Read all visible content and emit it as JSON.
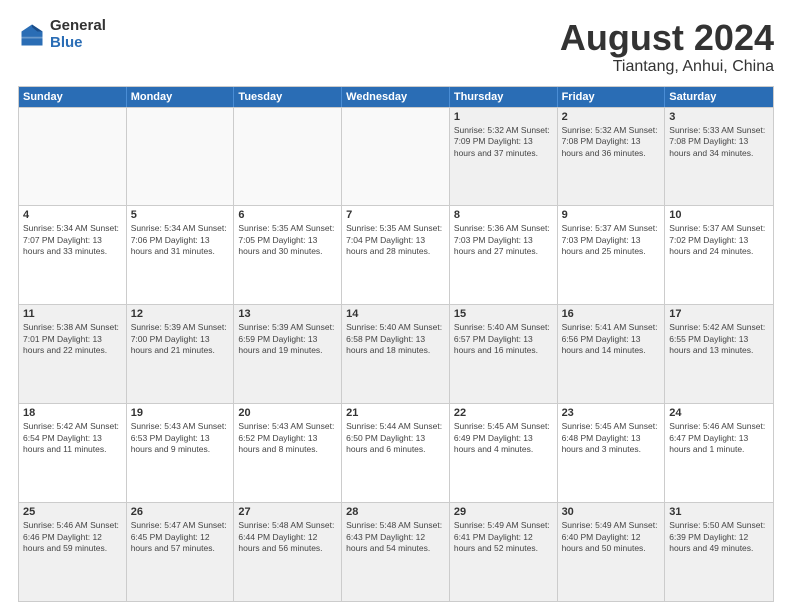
{
  "logo": {
    "general": "General",
    "blue": "Blue"
  },
  "title": "August 2024",
  "subtitle": "Tiantang, Anhui, China",
  "days_header": [
    "Sunday",
    "Monday",
    "Tuesday",
    "Wednesday",
    "Thursday",
    "Friday",
    "Saturday"
  ],
  "weeks": [
    [
      {
        "day": "",
        "info": ""
      },
      {
        "day": "",
        "info": ""
      },
      {
        "day": "",
        "info": ""
      },
      {
        "day": "",
        "info": ""
      },
      {
        "day": "1",
        "info": "Sunrise: 5:32 AM\nSunset: 7:09 PM\nDaylight: 13 hours\nand 37 minutes."
      },
      {
        "day": "2",
        "info": "Sunrise: 5:32 AM\nSunset: 7:08 PM\nDaylight: 13 hours\nand 36 minutes."
      },
      {
        "day": "3",
        "info": "Sunrise: 5:33 AM\nSunset: 7:08 PM\nDaylight: 13 hours\nand 34 minutes."
      }
    ],
    [
      {
        "day": "4",
        "info": "Sunrise: 5:34 AM\nSunset: 7:07 PM\nDaylight: 13 hours\nand 33 minutes."
      },
      {
        "day": "5",
        "info": "Sunrise: 5:34 AM\nSunset: 7:06 PM\nDaylight: 13 hours\nand 31 minutes."
      },
      {
        "day": "6",
        "info": "Sunrise: 5:35 AM\nSunset: 7:05 PM\nDaylight: 13 hours\nand 30 minutes."
      },
      {
        "day": "7",
        "info": "Sunrise: 5:35 AM\nSunset: 7:04 PM\nDaylight: 13 hours\nand 28 minutes."
      },
      {
        "day": "8",
        "info": "Sunrise: 5:36 AM\nSunset: 7:03 PM\nDaylight: 13 hours\nand 27 minutes."
      },
      {
        "day": "9",
        "info": "Sunrise: 5:37 AM\nSunset: 7:03 PM\nDaylight: 13 hours\nand 25 minutes."
      },
      {
        "day": "10",
        "info": "Sunrise: 5:37 AM\nSunset: 7:02 PM\nDaylight: 13 hours\nand 24 minutes."
      }
    ],
    [
      {
        "day": "11",
        "info": "Sunrise: 5:38 AM\nSunset: 7:01 PM\nDaylight: 13 hours\nand 22 minutes."
      },
      {
        "day": "12",
        "info": "Sunrise: 5:39 AM\nSunset: 7:00 PM\nDaylight: 13 hours\nand 21 minutes."
      },
      {
        "day": "13",
        "info": "Sunrise: 5:39 AM\nSunset: 6:59 PM\nDaylight: 13 hours\nand 19 minutes."
      },
      {
        "day": "14",
        "info": "Sunrise: 5:40 AM\nSunset: 6:58 PM\nDaylight: 13 hours\nand 18 minutes."
      },
      {
        "day": "15",
        "info": "Sunrise: 5:40 AM\nSunset: 6:57 PM\nDaylight: 13 hours\nand 16 minutes."
      },
      {
        "day": "16",
        "info": "Sunrise: 5:41 AM\nSunset: 6:56 PM\nDaylight: 13 hours\nand 14 minutes."
      },
      {
        "day": "17",
        "info": "Sunrise: 5:42 AM\nSunset: 6:55 PM\nDaylight: 13 hours\nand 13 minutes."
      }
    ],
    [
      {
        "day": "18",
        "info": "Sunrise: 5:42 AM\nSunset: 6:54 PM\nDaylight: 13 hours\nand 11 minutes."
      },
      {
        "day": "19",
        "info": "Sunrise: 5:43 AM\nSunset: 6:53 PM\nDaylight: 13 hours\nand 9 minutes."
      },
      {
        "day": "20",
        "info": "Sunrise: 5:43 AM\nSunset: 6:52 PM\nDaylight: 13 hours\nand 8 minutes."
      },
      {
        "day": "21",
        "info": "Sunrise: 5:44 AM\nSunset: 6:50 PM\nDaylight: 13 hours\nand 6 minutes."
      },
      {
        "day": "22",
        "info": "Sunrise: 5:45 AM\nSunset: 6:49 PM\nDaylight: 13 hours\nand 4 minutes."
      },
      {
        "day": "23",
        "info": "Sunrise: 5:45 AM\nSunset: 6:48 PM\nDaylight: 13 hours\nand 3 minutes."
      },
      {
        "day": "24",
        "info": "Sunrise: 5:46 AM\nSunset: 6:47 PM\nDaylight: 13 hours\nand 1 minute."
      }
    ],
    [
      {
        "day": "25",
        "info": "Sunrise: 5:46 AM\nSunset: 6:46 PM\nDaylight: 12 hours\nand 59 minutes."
      },
      {
        "day": "26",
        "info": "Sunrise: 5:47 AM\nSunset: 6:45 PM\nDaylight: 12 hours\nand 57 minutes."
      },
      {
        "day": "27",
        "info": "Sunrise: 5:48 AM\nSunset: 6:44 PM\nDaylight: 12 hours\nand 56 minutes."
      },
      {
        "day": "28",
        "info": "Sunrise: 5:48 AM\nSunset: 6:43 PM\nDaylight: 12 hours\nand 54 minutes."
      },
      {
        "day": "29",
        "info": "Sunrise: 5:49 AM\nSunset: 6:41 PM\nDaylight: 12 hours\nand 52 minutes."
      },
      {
        "day": "30",
        "info": "Sunrise: 5:49 AM\nSunset: 6:40 PM\nDaylight: 12 hours\nand 50 minutes."
      },
      {
        "day": "31",
        "info": "Sunrise: 5:50 AM\nSunset: 6:39 PM\nDaylight: 12 hours\nand 49 minutes."
      }
    ]
  ]
}
